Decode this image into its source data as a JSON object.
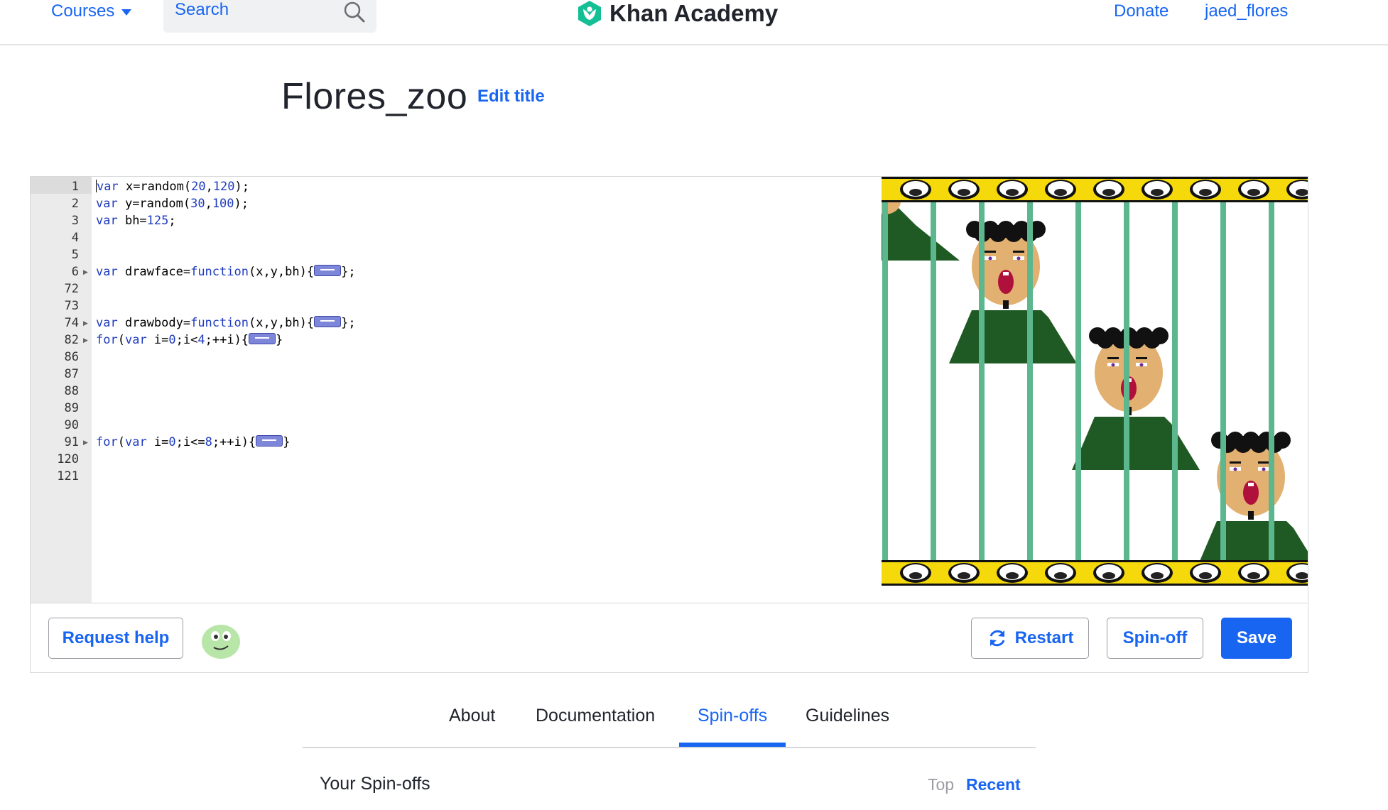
{
  "header": {
    "courses_label": "Courses",
    "search_placeholder": "Search",
    "logo_text": "Khan Academy",
    "donate_label": "Donate",
    "username": "jaed_flores"
  },
  "project": {
    "title": "Flores_zoo",
    "edit_title_label": "Edit title"
  },
  "editor": {
    "lines": [
      {
        "no": "1",
        "fold": false
      },
      {
        "no": "2",
        "fold": false
      },
      {
        "no": "3",
        "fold": false
      },
      {
        "no": "4",
        "fold": false
      },
      {
        "no": "5",
        "fold": false
      },
      {
        "no": "6",
        "fold": true
      },
      {
        "no": "72",
        "fold": false
      },
      {
        "no": "73",
        "fold": false
      },
      {
        "no": "74",
        "fold": true
      },
      {
        "no": "82",
        "fold": true
      },
      {
        "no": "86",
        "fold": false
      },
      {
        "no": "87",
        "fold": false
      },
      {
        "no": "88",
        "fold": false
      },
      {
        "no": "89",
        "fold": false
      },
      {
        "no": "90",
        "fold": false
      },
      {
        "no": "91",
        "fold": true
      },
      {
        "no": "120",
        "fold": false
      },
      {
        "no": "121",
        "fold": false
      }
    ],
    "code": {
      "l1_kw": "var",
      "l1_rest": " x=random(",
      "l1_a": "20",
      "l1_c": ",",
      "l1_b": "120",
      "l1_end": ");",
      "l2_kw": "var",
      "l2_rest": " y=random(",
      "l2_a": "30",
      "l2_c": ",",
      "l2_b": "100",
      "l2_end": ");",
      "l3_kw": "var",
      "l3_rest": " bh=",
      "l3_a": "125",
      "l3_end": ";",
      "l6_kw": "var",
      "l6_rest": " drawface=",
      "l6_fn": "function",
      "l6_args": "(x,y,bh){",
      "l6_end": "};",
      "l74_kw": "var",
      "l74_rest": " drawbody=",
      "l74_fn": "function",
      "l74_args": "(x,y,bh){",
      "l74_end": "};",
      "l82_kw": "for",
      "l82_a": "(",
      "l82_kw2": "var",
      "l82_rest": " i=",
      "l82_n1": "0",
      "l82_mid": ";i<",
      "l82_n2": "4",
      "l82_tail": ";++i){",
      "l82_end": "}",
      "l91_kw": "for",
      "l91_a": "(",
      "l91_kw2": "var",
      "l91_rest": " i=",
      "l91_n1": "0",
      "l91_mid": ";i<=",
      "l91_n2": "8",
      "l91_tail": ";++i){",
      "l91_end": "}"
    },
    "request_help_label": "Request help",
    "restart_label": "Restart",
    "spinoff_label": "Spin-off",
    "save_label": "Save"
  },
  "colors": {
    "accent": "#1865f2",
    "border_yellow": "#f5d90a",
    "bar_green": "#5cb68e",
    "shirt_green": "#1f5a24",
    "skin": "#e2b070"
  },
  "tabs": [
    {
      "label": "About",
      "active": false
    },
    {
      "label": "Documentation",
      "active": false
    },
    {
      "label": "Spin-offs",
      "active": true
    },
    {
      "label": "Guidelines",
      "active": false
    }
  ],
  "spinoffs": {
    "heading": "Your Spin-offs",
    "sort_top": "Top",
    "sort_recent": "Recent"
  }
}
